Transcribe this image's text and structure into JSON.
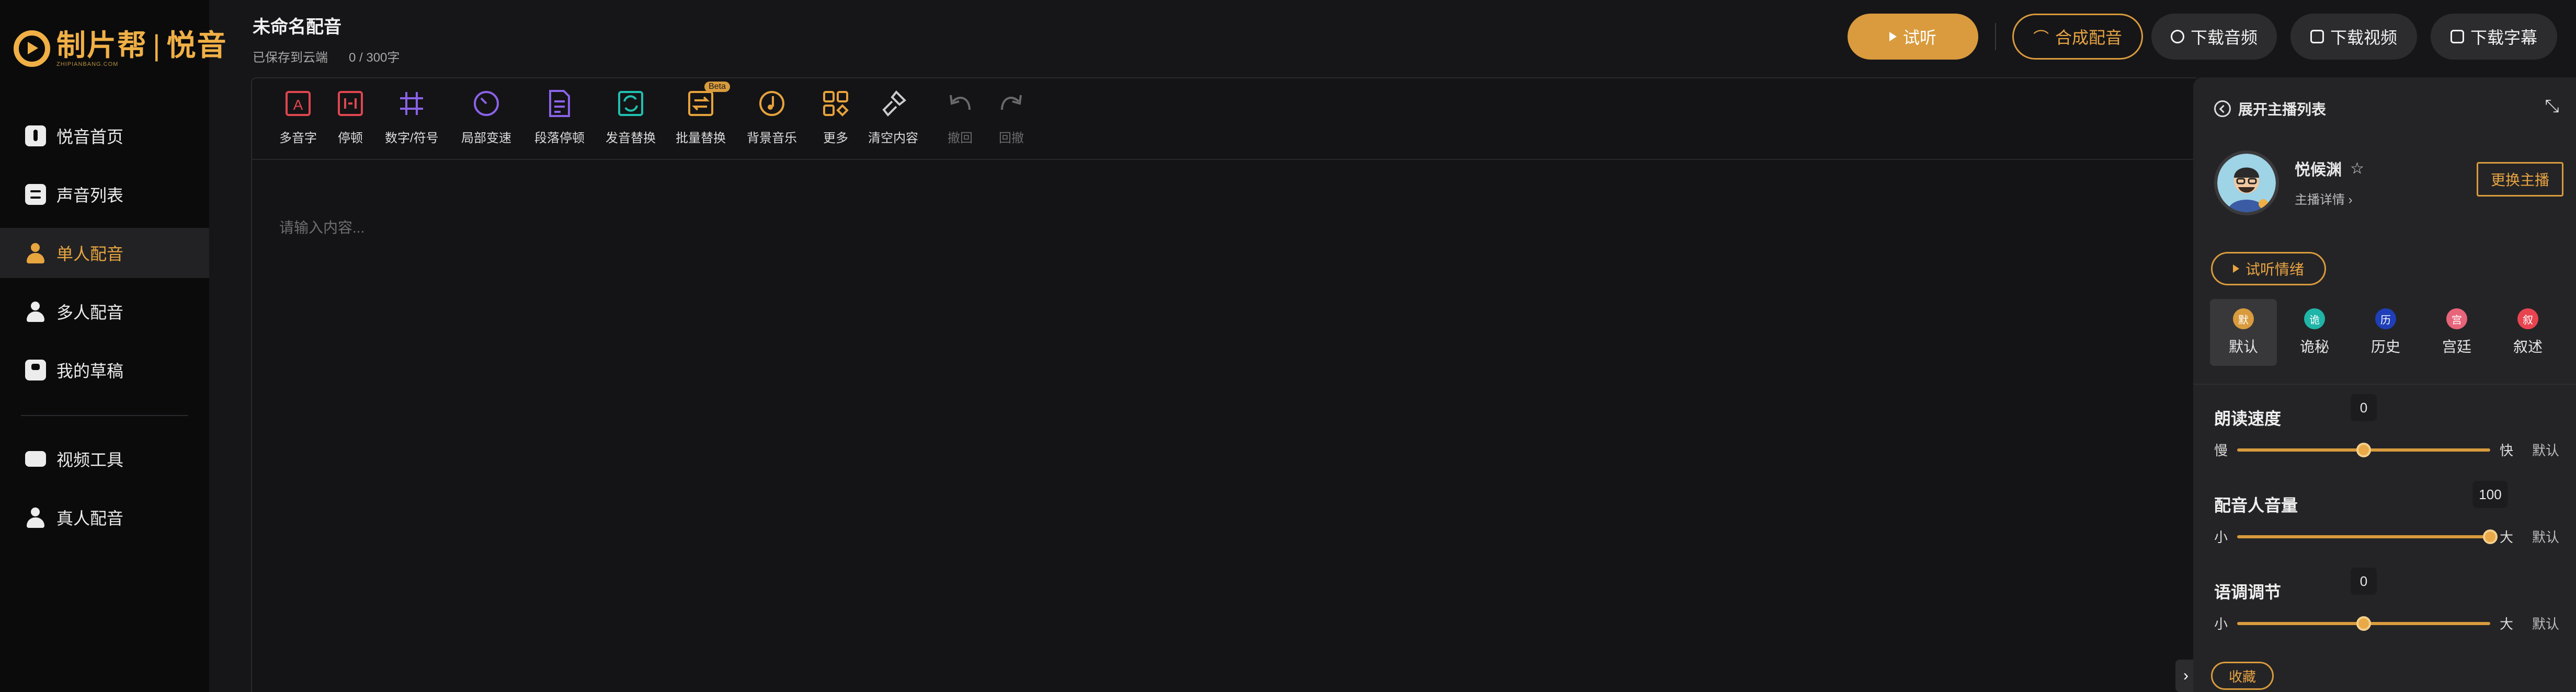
{
  "brand": {
    "name": "制片帮",
    "sub_name": "悦音",
    "tagline": "ZHIPIANBANG.COM",
    "accent": "#d99b3d"
  },
  "sidebar": {
    "items": [
      {
        "label": "悦音首页",
        "icon": "music-note-icon"
      },
      {
        "label": "声音列表",
        "icon": "list-icon"
      },
      {
        "label": "单人配音",
        "icon": "person-icon",
        "active": true
      },
      {
        "label": "多人配音",
        "icon": "person-icon"
      },
      {
        "label": "我的草稿",
        "icon": "save-icon"
      }
    ],
    "items2": [
      {
        "label": "视频工具",
        "icon": "video-icon"
      },
      {
        "label": "真人配音",
        "icon": "people-icon"
      }
    ]
  },
  "header": {
    "title": "未命名配音",
    "save_status": "已保存到云端",
    "word_count": "0 / 300字",
    "listen_label": "试听",
    "synth_label": "合成配音",
    "download_audio": "下载音频",
    "download_video": "下载视频",
    "download_subtitle": "下载字幕"
  },
  "toolbar": {
    "tools": [
      {
        "label": "多音字",
        "icon": "polyphone-icon",
        "color": "#e0464f"
      },
      {
        "label": "停顿",
        "icon": "pause-icon",
        "color": "#e0464f"
      },
      {
        "label": "数字/符号",
        "icon": "hash-icon",
        "color": "#8a63e8"
      },
      {
        "label": "局部变速",
        "icon": "speed-icon",
        "color": "#8a63e8"
      },
      {
        "label": "段落停顿",
        "icon": "paragraph-pause-icon",
        "color": "#8a63e8"
      },
      {
        "label": "发音替换",
        "icon": "replace-icon",
        "color": "#20c0b0"
      },
      {
        "label": "批量替换",
        "icon": "batch-replace-icon",
        "color": "#e6a23c",
        "badge": "Beta"
      },
      {
        "label": "背景音乐",
        "icon": "music-icon",
        "color": "#e6a23c"
      },
      {
        "label": "更多",
        "icon": "grid-icon",
        "color": "#e6a23c"
      },
      {
        "label": "清空内容",
        "icon": "broom-icon",
        "color": "#cccccc"
      },
      {
        "label": "撤回",
        "icon": "undo-icon",
        "color": "#6a6a6a",
        "disabled": true
      },
      {
        "label": "回撤",
        "icon": "redo-icon",
        "color": "#6a6a6a",
        "disabled": true
      }
    ]
  },
  "editor": {
    "placeholder": "请输入内容..."
  },
  "panel": {
    "title": "展开主播列表",
    "anchor_name": "悦候渊",
    "anchor_detail": "主播详情",
    "change_label": "更换主播",
    "emotion_label": "试听情绪",
    "emotions": [
      {
        "label": "默认",
        "glyph": "默",
        "color": "#d99b3d",
        "active": true
      },
      {
        "label": "诡秘",
        "glyph": "诡",
        "color": "#1fb5a8"
      },
      {
        "label": "历史",
        "glyph": "历",
        "color": "#1e3fb8"
      },
      {
        "label": "宫廷",
        "glyph": "宫",
        "color": "#e8647a"
      },
      {
        "label": "叙述",
        "glyph": "叙",
        "color": "#e84450"
      }
    ],
    "sliders": [
      {
        "label": "朗读速度",
        "value": "0",
        "fraction": 0.5,
        "min": "慢",
        "max": "快",
        "default": "默认"
      },
      {
        "label": "配音人音量",
        "value": "100",
        "fraction": 1.0,
        "min": "小",
        "max": "大",
        "default": "默认"
      },
      {
        "label": "语调调节",
        "value": "0",
        "fraction": 0.5,
        "min": "小",
        "max": "大",
        "default": "默认"
      }
    ],
    "collect_label": "收藏"
  }
}
